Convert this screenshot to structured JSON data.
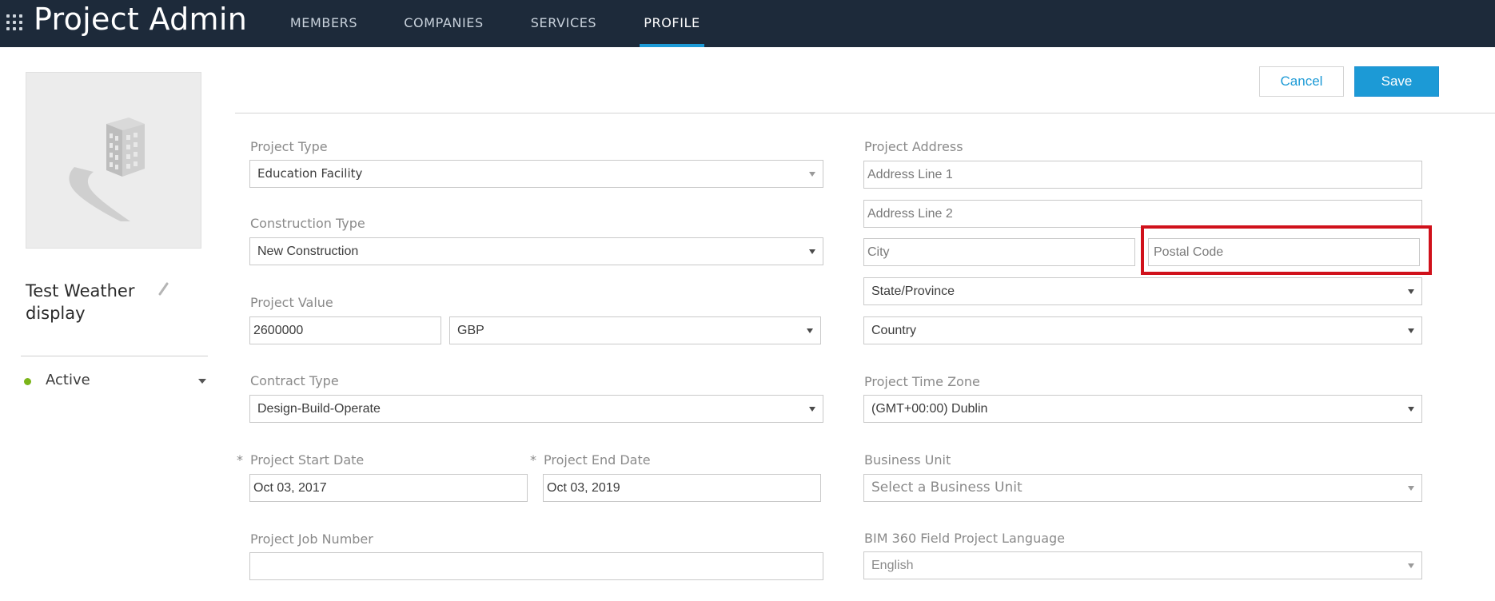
{
  "header": {
    "app_title": "Project Admin",
    "tabs": [
      {
        "label": "MEMBERS"
      },
      {
        "label": "COMPANIES"
      },
      {
        "label": "SERVICES"
      },
      {
        "label": "PROFILE"
      }
    ],
    "active_tab": "PROFILE",
    "accent_color": "#1c9ad6",
    "background_color": "#1d2a3a"
  },
  "sidebar": {
    "project_name": "Test Weather display",
    "thumbnail_icon": "building-icon",
    "edit_icon": "pencil-icon",
    "status": {
      "label": "Active",
      "color": "#7bb51a"
    }
  },
  "actions": {
    "cancel_label": "Cancel",
    "save_label": "Save"
  },
  "form": {
    "project_type": {
      "label": "Project Type",
      "value": "Education Facility"
    },
    "construction_type": {
      "label": "Construction Type",
      "value": "New Construction"
    },
    "project_value": {
      "label": "Project Value",
      "amount": "2600000",
      "currency": "GBP"
    },
    "contract_type": {
      "label": "Contract Type",
      "value": "Design-Build-Operate"
    },
    "required_marker": "*",
    "start_date": {
      "label": "Project Start Date",
      "value": "Oct 03, 2017"
    },
    "end_date": {
      "label": "Project End Date",
      "value": "Oct 03, 2019"
    },
    "job_number": {
      "label": "Project Job Number",
      "value": ""
    },
    "address": {
      "label": "Project Address",
      "line1_placeholder": "Address Line 1",
      "line2_placeholder": "Address Line 2",
      "city_placeholder": "City",
      "postal_placeholder": "Postal Code",
      "state_placeholder": "State/Province",
      "country_placeholder": "Country"
    },
    "time_zone": {
      "label": "Project Time Zone",
      "value": "(GMT+00:00) Dublin"
    },
    "business_unit": {
      "label": "Business Unit",
      "placeholder": "Select a Business Unit"
    },
    "language": {
      "label": "BIM 360 Field Project Language",
      "value": "English"
    }
  },
  "annotation": {
    "highlight_color": "#d0111b"
  }
}
